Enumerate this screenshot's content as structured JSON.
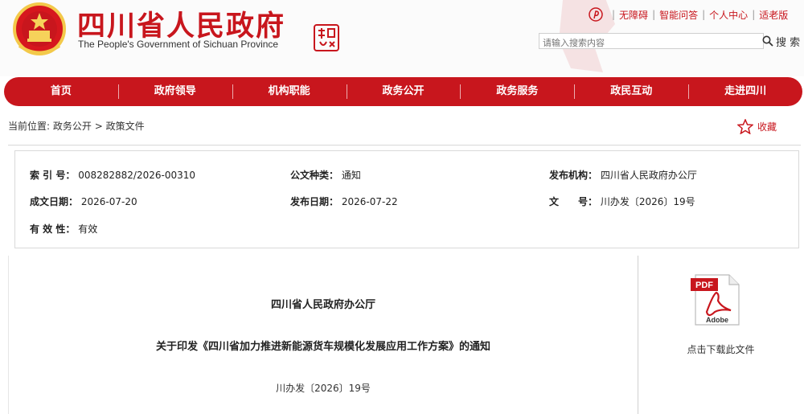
{
  "header": {
    "title": "四川省人民政府",
    "subtitle": "The People's Government of Sichuan Province",
    "top_links": [
      "无障碍",
      "智能问答",
      "个人中心",
      "适老版"
    ],
    "search": {
      "placeholder": "请输入搜索内容",
      "button_label": "搜 索"
    },
    "brand_color": "#c8161d"
  },
  "nav": {
    "items": [
      "首页",
      "政府领导",
      "机构职能",
      "政务公开",
      "政务服务",
      "政民互动",
      "走进四川"
    ]
  },
  "breadcrumb": {
    "prefix": "当前位置:",
    "items": [
      "政务公开",
      "政策文件"
    ],
    "separator": ">"
  },
  "favorite": {
    "label": "收藏",
    "icon": "star-icon"
  },
  "meta": {
    "index_no": {
      "label": "索 引 号：",
      "value": "008282882/2026-00310"
    },
    "doc_type": {
      "label": "公文种类：",
      "value": "通知"
    },
    "issuer": {
      "label": "发布机构：",
      "value": "四川省人民政府办公厅"
    },
    "created": {
      "label": "成文日期：",
      "value": "2026-07-20"
    },
    "published": {
      "label": "发布日期：",
      "value": "2026-07-22"
    },
    "doc_no": {
      "label": "文　　号：",
      "value": "川办发〔2026〕19号"
    },
    "validity": {
      "label": "有 效 性：",
      "value": "有效"
    }
  },
  "document": {
    "issuer": "四川省人民政府办公厅",
    "title": "关于印发《四川省加力推进新能源货车规模化发展应用工作方案》的通知",
    "number": "川办发〔2026〕19号"
  },
  "download": {
    "pdf_label": "PDF",
    "brand_label": "Adobe",
    "label": "点击下载此文件"
  }
}
